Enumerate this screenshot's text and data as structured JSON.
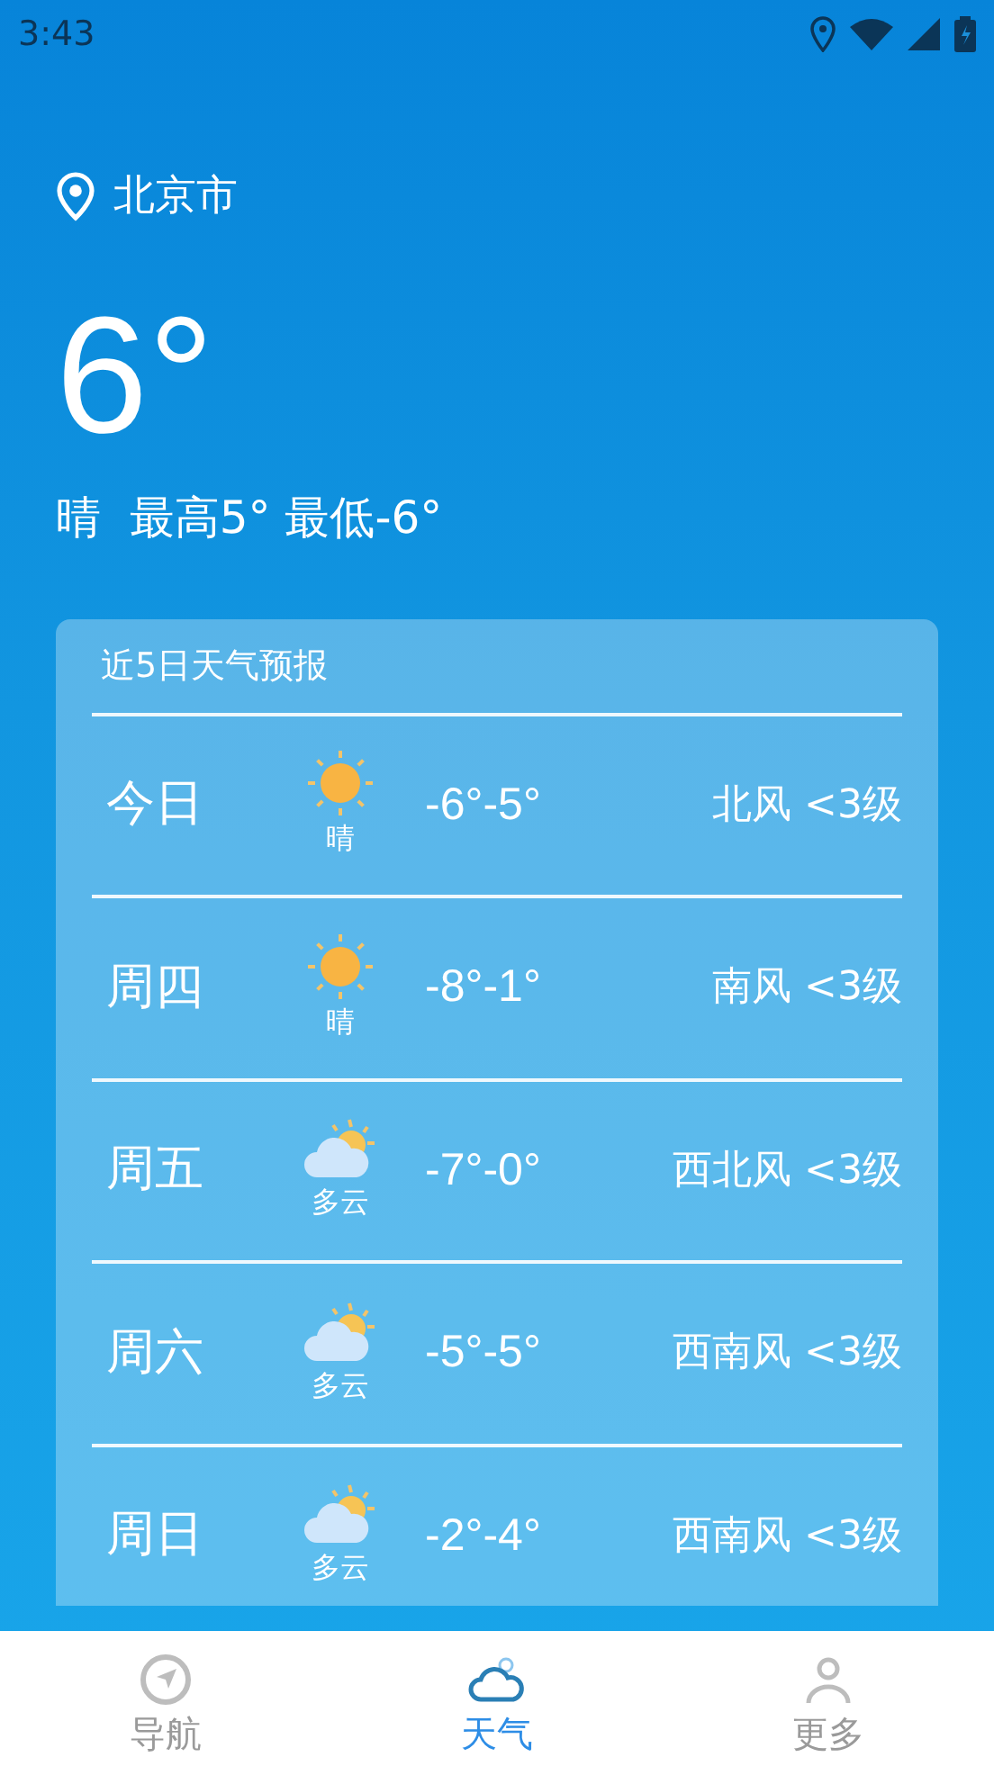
{
  "status_bar": {
    "time": "3:43"
  },
  "location": {
    "city": "北京市"
  },
  "current": {
    "temp": "6°",
    "summary": "晴  最高5° 最低-6°"
  },
  "forecast": {
    "title": "近5日天气预报",
    "days": [
      {
        "day": "今日",
        "kind": "sunny",
        "condition": "晴",
        "temps": "-6°-5°",
        "wind": "北风 <3级"
      },
      {
        "day": "周四",
        "kind": "sunny",
        "condition": "晴",
        "temps": "-8°-1°",
        "wind": "南风 <3级"
      },
      {
        "day": "周五",
        "kind": "cloudy",
        "condition": "多云",
        "temps": "-7°-0°",
        "wind": "西北风 <3级"
      },
      {
        "day": "周六",
        "kind": "cloudy",
        "condition": "多云",
        "temps": "-5°-5°",
        "wind": "西南风 <3级"
      },
      {
        "day": "周日",
        "kind": "cloudy",
        "condition": "多云",
        "temps": "-2°-4°",
        "wind": "西南风 <3级"
      }
    ]
  },
  "bottom_nav": [
    {
      "label": "导航",
      "kind": "compass",
      "selected": false
    },
    {
      "label": "天气",
      "kind": "cloud",
      "selected": true
    },
    {
      "label": "更多",
      "kind": "person",
      "selected": false
    }
  ]
}
